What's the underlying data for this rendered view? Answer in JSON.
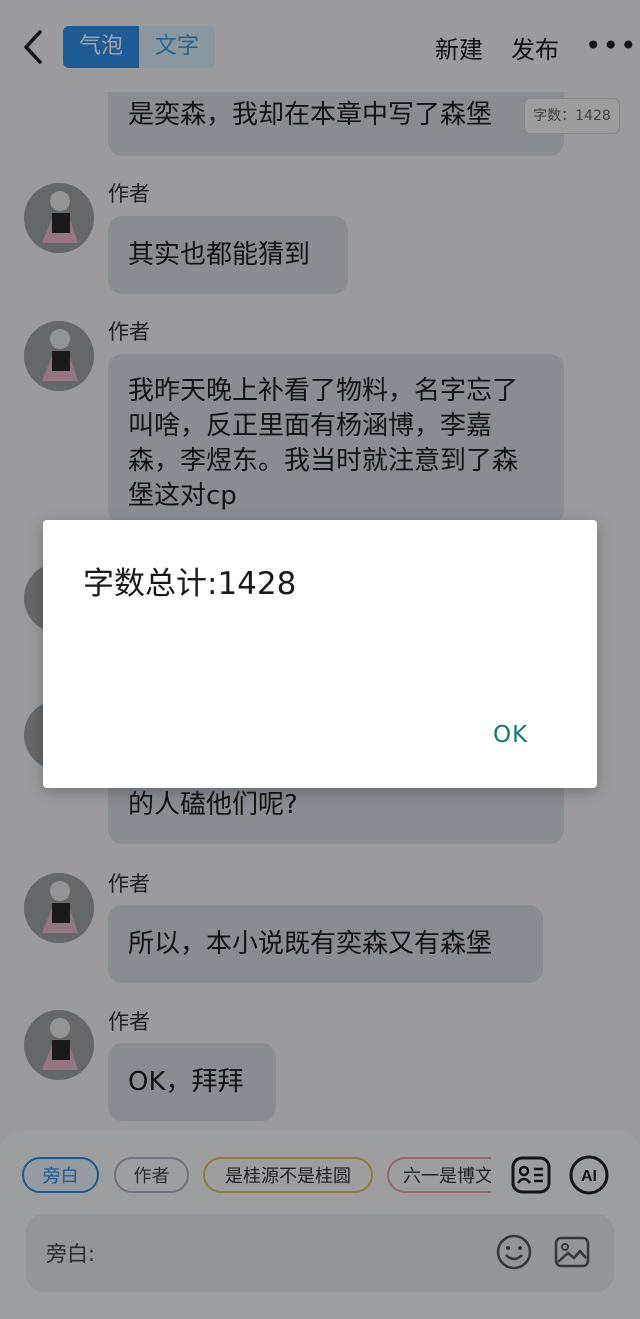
{
  "header": {
    "mode_bubble": "气泡",
    "mode_text": "文字",
    "new_label": "新建",
    "publish_label": "发布",
    "more_label": "•••"
  },
  "word_count_badge": "字数：1428",
  "messages": [
    {
      "author": "",
      "text": "是奕森，我却在本章中写了森堡"
    },
    {
      "author": "作者",
      "text": "其实也都能猜到"
    },
    {
      "author": "作者",
      "text_lines": [
        "我昨天晚上补看了物料，名字忘了",
        "叫啥，反正里面有杨涵博，李嘉",
        "森，李煜东。我当时就注意到了森",
        "堡这对cp"
      ]
    },
    {
      "author": "",
      "text": "的人磕他们呢?"
    },
    {
      "author": "作者",
      "text": "所以，本小说既有奕森又有森堡"
    },
    {
      "author": "作者",
      "text": "OK，拜拜"
    }
  ],
  "chips": [
    "旁白",
    "作者",
    "是桂源不是桂圆",
    "六一是博文"
  ],
  "input": {
    "placeholder": "旁白:"
  },
  "dialog": {
    "title": "字数总计:1428",
    "ok_label": "OK"
  },
  "colors": {
    "accent": "#2f8ee6",
    "bubble": "#d6dbe3",
    "ok": "#0e7d68"
  }
}
